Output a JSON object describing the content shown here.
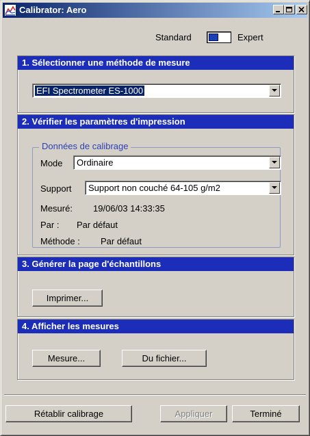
{
  "window": {
    "title": "Calibrator: Aero"
  },
  "mode_toggle": {
    "left_label": "Standard",
    "right_label": "Expert"
  },
  "sections": [
    {
      "title": "1. Sélectionner une méthode de mesure"
    },
    {
      "title": "2. Vérifier les paramètres d'impression"
    },
    {
      "title": "3. Générer la page d'échantillons"
    },
    {
      "title": "4. Afficher les mesures"
    }
  ],
  "measurement_method": {
    "selected": "EFI Spectrometer ES-1000"
  },
  "calibration_data": {
    "legend": "Données de calibrage",
    "mode_label": "Mode",
    "mode_value": "Ordinaire",
    "support_label": "Support",
    "support_value": "Support non couché 64-105 g/m2",
    "measured_label": "Mesuré:",
    "measured_value": "19/06/03 14:33:35",
    "by_label": "Par :",
    "by_value": "Par défaut",
    "method_label": "Méthode :",
    "method_value": "Par défaut"
  },
  "print_section": {
    "print_button": "Imprimer..."
  },
  "measures_section": {
    "measure_button": "Mesure...",
    "from_file_button": "Du fichier..."
  },
  "footer": {
    "reset_button": "Rétablir calibrage",
    "apply_button": "Appliquer",
    "done_button": "Terminé"
  }
}
